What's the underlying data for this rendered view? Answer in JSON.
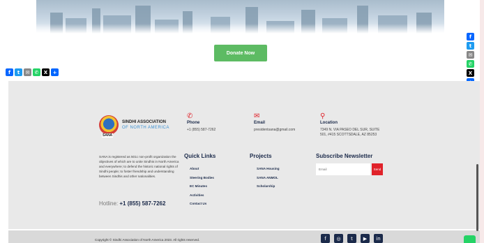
{
  "donate": {
    "label": "Donate Now"
  },
  "share": {
    "left_icons": [
      "facebook-icon",
      "twitter-icon",
      "email-icon",
      "whatsapp-icon",
      "x-icon",
      "share-plus-icon"
    ],
    "right_icons": [
      "facebook-icon",
      "twitter-icon",
      "email-icon",
      "whatsapp-icon",
      "x-icon",
      "share-plus-icon"
    ]
  },
  "brand": {
    "logo_text": "SANA",
    "name": "SINDHI ASSOCIATION",
    "sub": "OF NORTH AMERICA"
  },
  "contact": {
    "phone": {
      "title": "Phone",
      "value": "+1 (855) 587-7262"
    },
    "email": {
      "title": "Email",
      "value": "presidentsana@gmail.com"
    },
    "location": {
      "title": "Location",
      "line1": "7349 N. VIA PASEO DEL SUR, SUITE",
      "line2": "501, #415 SCOTTSDALE, AZ 85253"
    }
  },
  "about": {
    "text": "SANA is registered as 501c non-profit organization the objectives of which are to unite Sindhis in North America and everywhere; to defend the historic national rights of Sindhi people; to foster friendship and understanding between Sindhis and other nationalities.",
    "hotline_label": "Hotline:",
    "hotline_number": "+1 (855) 587-7262"
  },
  "quick_links": {
    "title": "Quick Links",
    "items": [
      "About",
      "Steering Bodies",
      "EC Minutes",
      "Activities",
      "Contact Us"
    ]
  },
  "projects": {
    "title": "Projects",
    "items": [
      "SANA Housing",
      "SANA ANMOL",
      "Scholarship"
    ]
  },
  "newsletter": {
    "title": "Subscribe Newsletter",
    "placeholder": "Email",
    "send_label": "Send"
  },
  "copyright": "Copyright © Sindhi Association of North America 2023. All rights reserved.",
  "socials": [
    "facebook-icon",
    "instagram-icon",
    "twitter-icon",
    "youtube-icon",
    "linkedin-icon"
  ],
  "colors": {
    "accent_green": "#5dbb63",
    "accent_red": "#e0222a",
    "navy": "#1b2a4a",
    "footer_bg": "#e9e9e9"
  }
}
